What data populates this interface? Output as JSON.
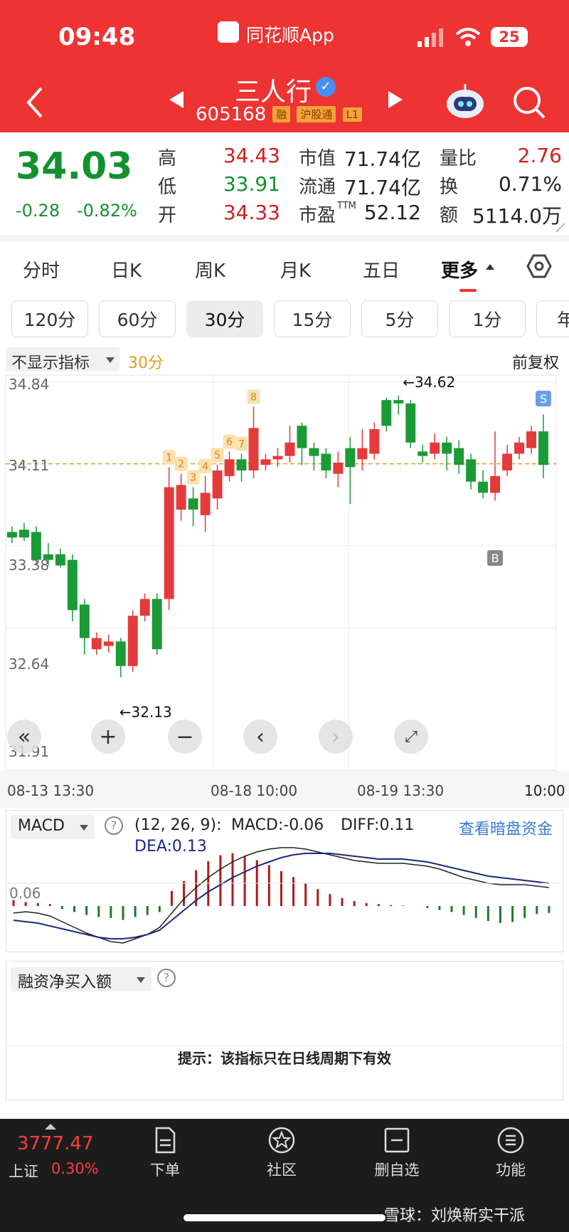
{
  "status_bar": {
    "time": "09:48",
    "app_name": "同花顺App",
    "battery": "25"
  },
  "header": {
    "title": "三人行",
    "code": "605168",
    "badges": [
      "融",
      "沪股通",
      "L1"
    ]
  },
  "quote": {
    "price": "34.03",
    "change": "-0.28",
    "change_pct": "-0.82%",
    "high_label": "高",
    "high": "34.43",
    "low_label": "低",
    "low": "33.91",
    "open_label": "开",
    "open": "34.33",
    "mktcap_label": "市值",
    "mktcap": "71.74亿",
    "float_label": "流通",
    "float": "71.74亿",
    "pe_label": "市盈",
    "pe_sup": "TTM",
    "pe": "52.12",
    "vol_ratio_label": "量比",
    "vol_ratio": "2.76",
    "turnover_label": "换",
    "turnover": "0.71%",
    "amount_label": "额",
    "amount": "5114.0万"
  },
  "tabs": [
    "分时",
    "日K",
    "周K",
    "月K",
    "五日",
    "更多"
  ],
  "periods": [
    "120分",
    "60分",
    "30分",
    "15分",
    "5分",
    "1分",
    "年"
  ],
  "selected_period": "30分",
  "chart_toolbar": {
    "indicator": "不显示指标",
    "period": "30分",
    "adjust": "前复权"
  },
  "chart_data": {
    "type": "candlestick",
    "ylim": [
      31.91,
      34.84
    ],
    "y_ticks": [
      "34.84",
      "34.11",
      "33.38",
      "32.64",
      "31.91"
    ],
    "x_labels": [
      "08-13 13:30",
      "08-18 10:00",
      "08-19 13:30",
      "10:00"
    ],
    "ref_line": 34.11,
    "max_label": "←34.62",
    "min_label": "←32.13",
    "markers": [
      "1",
      "2",
      "3",
      "4",
      "5",
      "6",
      "7",
      "8"
    ],
    "signals": {
      "sell": "S",
      "buy": "B"
    },
    "candles": [
      [
        33.5,
        33.45,
        33.55,
        33.4
      ],
      [
        33.52,
        33.45,
        33.58,
        33.42
      ],
      [
        33.5,
        33.25,
        33.55,
        33.2
      ],
      [
        33.3,
        33.25,
        33.4,
        33.2
      ],
      [
        33.3,
        33.2,
        33.35,
        33.18
      ],
      [
        33.25,
        32.8,
        33.3,
        32.7
      ],
      [
        32.85,
        32.55,
        32.9,
        32.4
      ],
      [
        32.45,
        32.55,
        32.6,
        32.4
      ],
      [
        32.48,
        32.52,
        32.58,
        32.42
      ],
      [
        32.52,
        32.3,
        32.55,
        32.2
      ],
      [
        32.3,
        32.75,
        32.8,
        32.25
      ],
      [
        32.75,
        32.9,
        32.95,
        32.7
      ],
      [
        32.9,
        32.45,
        32.95,
        32.4
      ],
      [
        32.9,
        33.9,
        34.08,
        32.8
      ],
      [
        33.7,
        33.92,
        34.02,
        33.6
      ],
      [
        33.8,
        33.7,
        33.9,
        33.55
      ],
      [
        33.65,
        33.85,
        34.0,
        33.5
      ],
      [
        33.8,
        34.05,
        34.1,
        33.7
      ],
      [
        34.0,
        34.15,
        34.22,
        33.95
      ],
      [
        34.15,
        34.05,
        34.2,
        33.95
      ],
      [
        34.05,
        34.43,
        34.62,
        33.98
      ],
      [
        34.1,
        34.15,
        34.2,
        34.05
      ],
      [
        34.15,
        34.18,
        34.25,
        34.08
      ],
      [
        34.18,
        34.3,
        34.45,
        34.12
      ],
      [
        34.45,
        34.25,
        34.48,
        34.1
      ],
      [
        34.25,
        34.18,
        34.3,
        34.05
      ],
      [
        34.2,
        34.05,
        34.25,
        33.98
      ],
      [
        34.02,
        34.12,
        34.22,
        33.9
      ],
      [
        34.25,
        34.08,
        34.35,
        33.75
      ],
      [
        34.15,
        34.25,
        34.42,
        34.05
      ],
      [
        34.2,
        34.42,
        34.48,
        34.15
      ],
      [
        34.68,
        34.45,
        34.7,
        34.4
      ],
      [
        34.68,
        34.65,
        34.72,
        34.55
      ],
      [
        34.65,
        34.3,
        34.68,
        34.25
      ],
      [
        34.22,
        34.18,
        34.28,
        34.12
      ],
      [
        34.2,
        34.3,
        34.38,
        34.15
      ],
      [
        34.3,
        34.2,
        34.35,
        34.05
      ],
      [
        34.25,
        34.1,
        34.32,
        34.02
      ],
      [
        34.15,
        33.95,
        34.2,
        33.88
      ],
      [
        33.95,
        33.85,
        34.05,
        33.8
      ],
      [
        33.85,
        34.0,
        34.4,
        33.78
      ],
      [
        34.05,
        34.2,
        34.28,
        34.0
      ],
      [
        34.2,
        34.3,
        34.35,
        34.15
      ],
      [
        34.25,
        34.4,
        34.45,
        34.2
      ],
      [
        34.4,
        34.1,
        34.55,
        33.98
      ]
    ]
  },
  "macd": {
    "title": "MACD",
    "params": "(12, 26, 9):",
    "macd": "MACD:-0.06",
    "diff": "DIFF:0.11",
    "dea": "DEA:0.13",
    "link": "查看暗盘资金",
    "ref": "0.06"
  },
  "margin_panel": {
    "title": "融资净买入额",
    "hint": "提示：该指标只在日线周期下有效"
  },
  "bottom_bar": {
    "index_value": "3777.47",
    "index_name": "上证",
    "index_change": "0.30%",
    "items": [
      "下单",
      "社区",
      "删自选",
      "功能"
    ],
    "watermark": "雪球：刘焕新实干派"
  }
}
